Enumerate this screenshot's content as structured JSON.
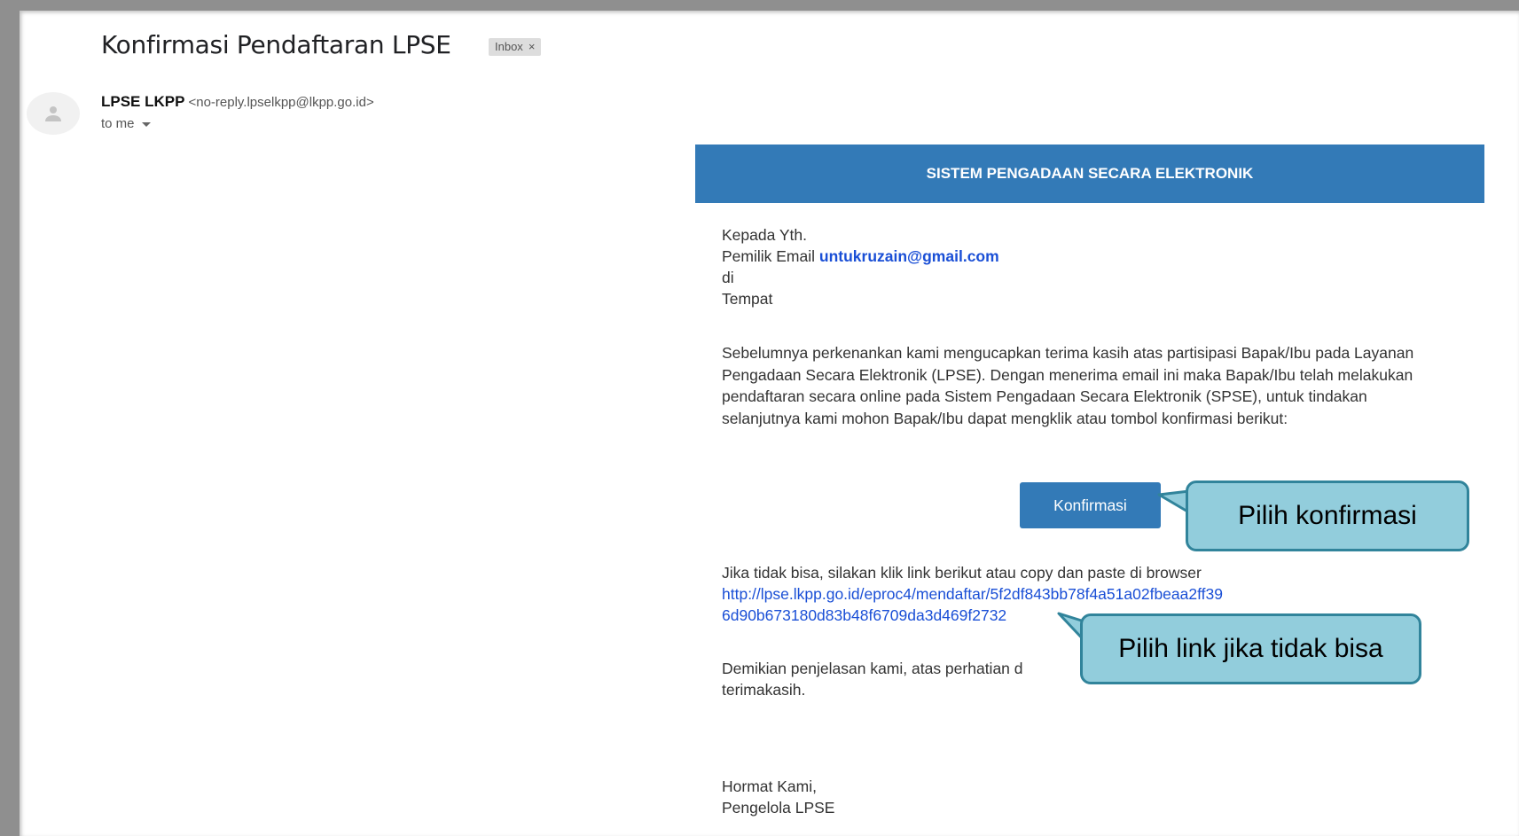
{
  "email": {
    "subject": "Konfirmasi Pendaftaran LPSE",
    "label_badge": "Inbox",
    "label_close": "×",
    "sender_name": "LPSE LKPP",
    "sender_address": "<no-reply.lpselkpp@lkpp.go.id>",
    "recipient": "to me"
  },
  "message": {
    "banner": "SISTEM PENGADAAN SECARA ELEKTRONIK",
    "greeting_line1": "Kepada Yth.",
    "greeting_line2_prefix": "Pemilik Email ",
    "greeting_email": "untukruzain@gmail.com",
    "greeting_line3": "di",
    "greeting_line4": "Tempat",
    "paragraph": "Sebelumnya perkenankan kami mengucapkan terima kasih atas partisipasi Bapak/Ibu pada Layanan Pengadaan Secara Elektronik (LPSE). Dengan menerima email ini maka Bapak/Ibu telah melakukan pendaftaran secara online pada Sistem Pengadaan Secara Elektronik (SPSE), untuk tindakan selanjutnya kami mohon Bapak/Ibu dapat mengklik atau tombol konfirmasi berikut:",
    "confirm_button": "Konfirmasi",
    "fallback_text": "Jika tidak bisa, silakan klik link berikut atau copy dan paste di browser",
    "link_line1": "http://lpse.lkpp.go.id/eproc4/mendaftar/5f2df843bb78f4a51a02fbeaa2ff39",
    "link_line2": "6d90b673180d83b48f6709da3d469f2732",
    "closing_line1": "Demikian penjelasan kami, atas perhatian d",
    "closing_line2": "terimakasih.",
    "signoff_line1": "Hormat Kami,",
    "signoff_line2": "Pengelola LPSE"
  },
  "annotations": {
    "callout_confirm": "Pilih konfirmasi",
    "callout_link": "Pilih link jika tidak bisa"
  },
  "colors": {
    "banner": "#337ab7",
    "button": "#337ab7",
    "link": "#1a4fd6",
    "callout_fill": "#92cddc",
    "callout_border": "#31849b"
  }
}
